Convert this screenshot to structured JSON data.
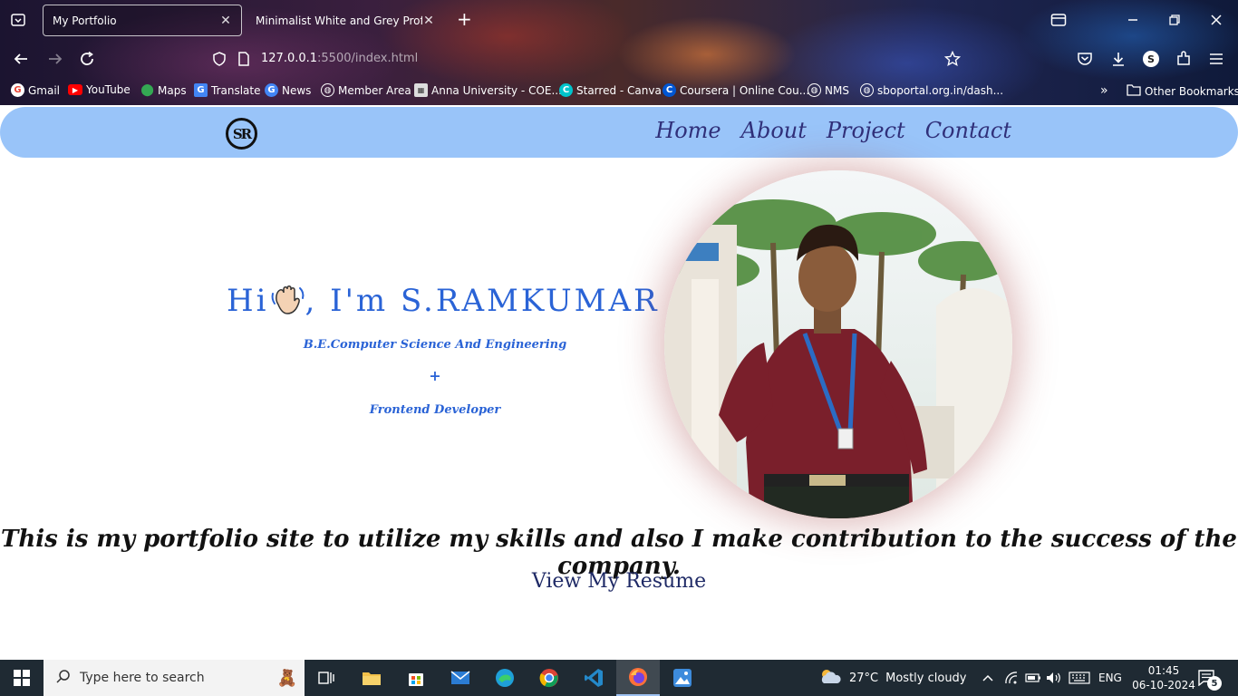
{
  "browser": {
    "tabs": [
      {
        "title": "My Portfolio",
        "active": true
      },
      {
        "title": "Minimalist White and Grey Professi",
        "active": false
      }
    ],
    "url": {
      "host": "127.0.0.1",
      "rest": ":5500/index.html"
    },
    "bookmarks": [
      {
        "label": "Gmail",
        "icon": "gmail-icon",
        "color": "#ea4335"
      },
      {
        "label": "YouTube",
        "icon": "youtube-icon",
        "color": "#ff0000"
      },
      {
        "label": "Maps",
        "icon": "maps-icon",
        "color": "#34a853"
      },
      {
        "label": "Translate",
        "icon": "translate-icon",
        "color": "#4285f4"
      },
      {
        "label": "News",
        "icon": "news-icon",
        "color": "#4285f4"
      },
      {
        "label": "Member Area",
        "icon": "globe-icon",
        "color": "#ffffff"
      },
      {
        "label": "Anna University - COE...",
        "icon": "university-icon",
        "color": "#cccccc"
      },
      {
        "label": "Starred - Canva",
        "icon": "canva-icon",
        "color": "#00c4cc"
      },
      {
        "label": "Coursera | Online Cou...",
        "icon": "coursera-icon",
        "color": "#0056d2"
      },
      {
        "label": "NMS",
        "icon": "globe-icon",
        "color": "#ffffff"
      },
      {
        "label": "sboportal.org.in/dash...",
        "icon": "globe-icon",
        "color": "#ffffff"
      }
    ],
    "other_bookmarks": "Other Bookmarks",
    "profile_initial": "S"
  },
  "site": {
    "nav": [
      "Home",
      "About",
      "Project",
      "Contact"
    ],
    "logo_text": "SR",
    "hero": {
      "greeting_start": "Hi",
      "greeting_end": ", I'm S.RAMKUMAR",
      "degree": "B.E.Computer Science And Engineering",
      "plus": "+",
      "role": "Frontend Developer"
    },
    "tagline": "This is my portfolio site to utilize my skills and also I make contribution to the success of the company.",
    "resume_link": "View My Resume"
  },
  "taskbar": {
    "search_placeholder": "Type here to search",
    "weather": {
      "temp": "27°C",
      "condition": "Mostly cloudy"
    },
    "language": "ENG",
    "time": "01:45",
    "date": "06-10-2024",
    "notification_count": "5",
    "apps": [
      "task-view-icon",
      "file-explorer-icon",
      "store-icon",
      "mail-icon",
      "edge-icon",
      "chrome-icon",
      "vscode-icon",
      "firefox-icon",
      "photos-icon"
    ]
  },
  "colors": {
    "nav_bg": "#99c4f9",
    "nav_link": "#30307a",
    "hero_blue": "#2a63d6",
    "resume_link": "#1f2a66"
  }
}
